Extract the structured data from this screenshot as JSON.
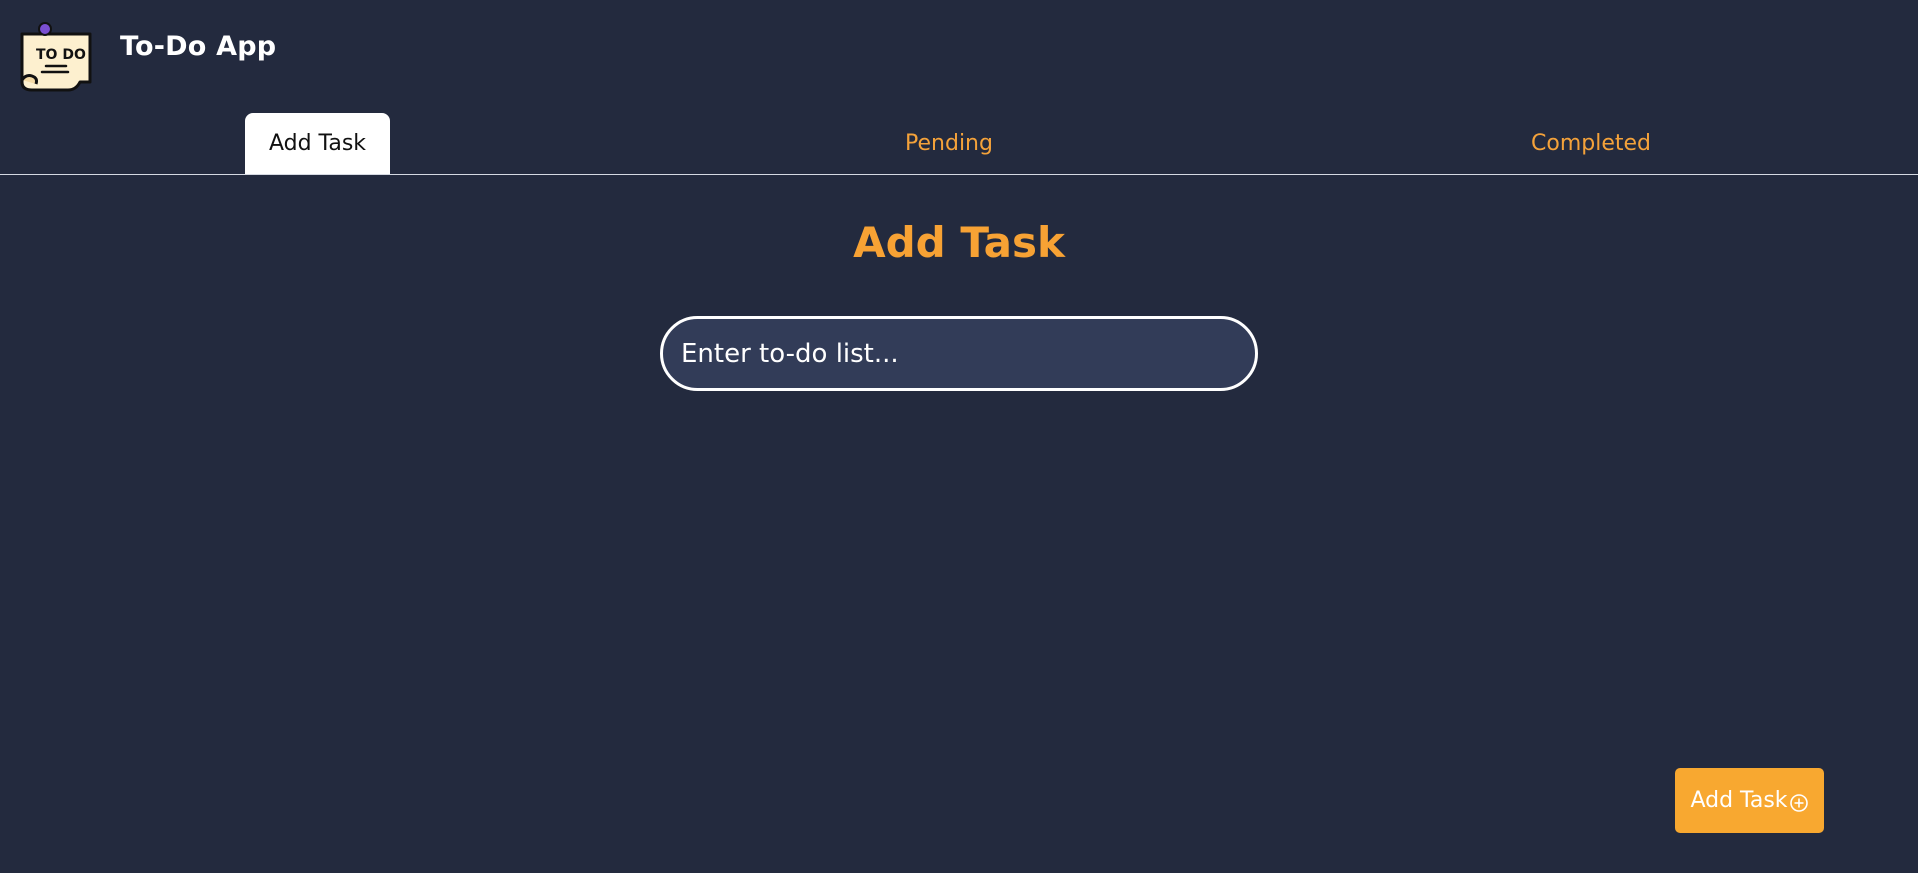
{
  "header": {
    "logo_text": "TO DO",
    "title": "To-Do App"
  },
  "tabs": [
    {
      "label": "Add Task",
      "active": true
    },
    {
      "label": "Pending",
      "active": false
    },
    {
      "label": "Completed",
      "active": false
    }
  ],
  "main": {
    "heading": "Add Task",
    "input": {
      "value": "",
      "placeholder": "Enter to-do list..."
    },
    "add_button": {
      "label": "Add Task",
      "icon": "plus-circle-icon"
    }
  },
  "colors": {
    "background": "#232a3e",
    "accent": "#f7a234",
    "input_background": "#323c58",
    "active_tab": "#ffffff"
  }
}
